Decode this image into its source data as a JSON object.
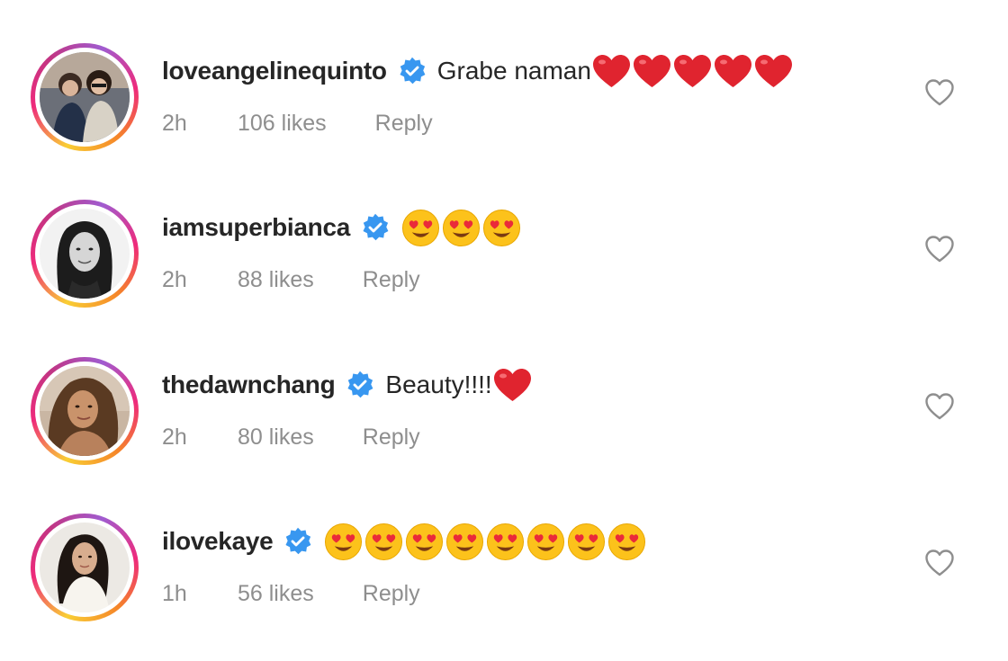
{
  "comments": [
    {
      "username": "loveangelinequinto",
      "text": "Grabe naman",
      "emoji": "red-heart",
      "emoji_count": 5,
      "time": "2h",
      "likes": "106 likes",
      "reply": "Reply"
    },
    {
      "username": "iamsuperbianca",
      "text": "",
      "emoji": "heart-eyes",
      "emoji_count": 3,
      "time": "2h",
      "likes": "88 likes",
      "reply": "Reply"
    },
    {
      "username": "thedawnchang",
      "text": "Beauty!!!!",
      "emoji": "red-heart",
      "emoji_count": 1,
      "time": "2h",
      "likes": "80 likes",
      "reply": "Reply"
    },
    {
      "username": "ilovekaye",
      "text": "",
      "emoji": "heart-eyes",
      "emoji_count": 8,
      "time": "1h",
      "likes": "56 likes",
      "reply": "Reply"
    }
  ],
  "icons": {
    "verified": "verified-badge-icon",
    "like": "heart-outline-icon"
  },
  "colors": {
    "verified_blue": "#3897f0",
    "meta_gray": "#8e8e8e",
    "heart_red": "#e0242f"
  }
}
